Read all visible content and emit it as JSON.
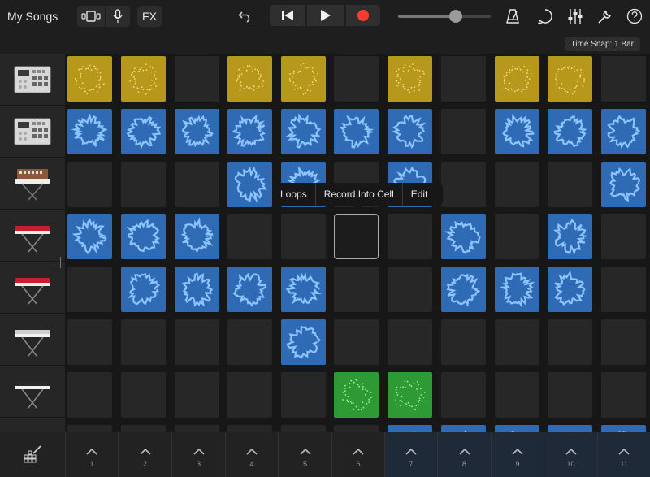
{
  "toolbar": {
    "my_songs": "My Songs",
    "fx": "FX",
    "volume_level": 0.62,
    "record_color": "#ff3b30"
  },
  "time_snap": "Time Snap: 1 Bar",
  "popup": {
    "loops": "Loops",
    "record": "Record Into Cell",
    "edit": "Edit"
  },
  "footer": {
    "columns": [
      "1",
      "2",
      "3",
      "4",
      "5",
      "6",
      "7",
      "8",
      "9",
      "10",
      "11"
    ]
  },
  "colors": {
    "drums": "#b8981a",
    "audio": "#2f6bb5",
    "midi": "#2d9a34",
    "empty": "#272727"
  },
  "instruments": [
    "drum-machine",
    "drum-machine",
    "synth-keyboard",
    "red-keyboard",
    "red-keyboard",
    "silver-keyboard",
    "black-keyboard",
    "partial"
  ],
  "grid": [
    [
      "yellow",
      "yellow",
      "empty",
      "yellow",
      "yellow",
      "empty",
      "yellow",
      "empty",
      "yellow",
      "yellow",
      "empty"
    ],
    [
      "blue",
      "blue",
      "blue",
      "blue",
      "blue",
      "blue",
      "blue",
      "empty",
      "blue",
      "blue",
      "blue"
    ],
    [
      "empty",
      "empty",
      "empty",
      "blue",
      "blue",
      "empty",
      "blue",
      "empty",
      "empty",
      "empty",
      "blue"
    ],
    [
      "blue",
      "blue",
      "blue",
      "empty",
      "empty",
      "selected",
      "empty",
      "blue",
      "empty",
      "blue",
      "empty"
    ],
    [
      "empty",
      "blue",
      "blue",
      "blue",
      "blue",
      "empty",
      "empty",
      "blue",
      "blue",
      "blue",
      "empty"
    ],
    [
      "empty",
      "empty",
      "empty",
      "empty",
      "blue",
      "empty",
      "empty",
      "empty",
      "empty",
      "empty",
      "empty"
    ],
    [
      "empty",
      "empty",
      "empty",
      "empty",
      "empty",
      "green",
      "green",
      "empty",
      "empty",
      "empty",
      "empty"
    ],
    [
      "empty",
      "empty",
      "empty",
      "empty",
      "empty",
      "empty",
      "blue",
      "blue",
      "blue",
      "blue",
      "blue"
    ]
  ]
}
